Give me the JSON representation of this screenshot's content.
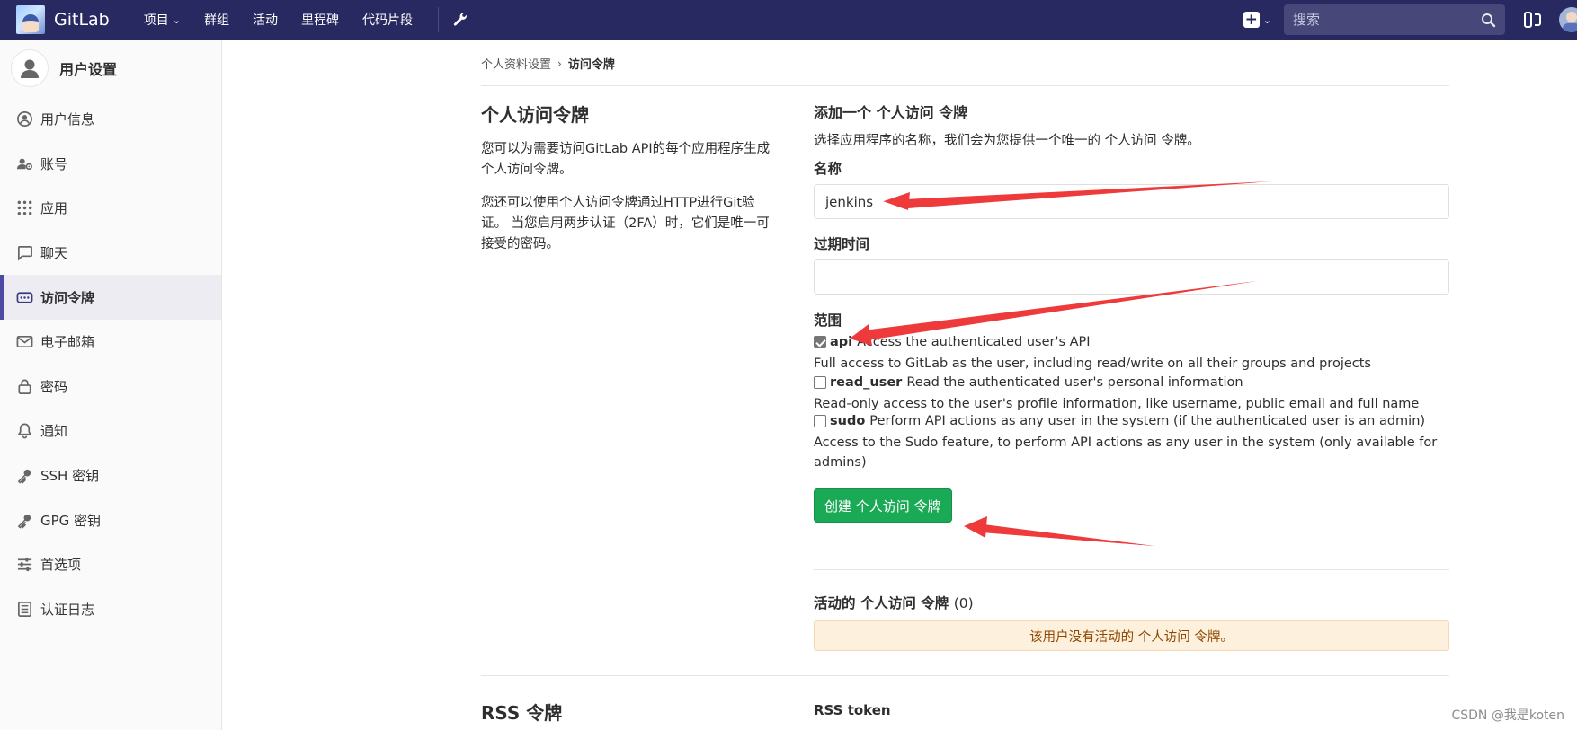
{
  "page": {
    "title": "GitLab",
    "watermark": "CSDN @我是koten"
  },
  "colors": {
    "navbar": "#292961",
    "accent": "#4b4ba3",
    "green": "#1aaa55",
    "arrow": "#ee3a3a"
  },
  "navbar": {
    "brand": "GitLab",
    "menu": [
      "项目",
      "群组",
      "活动",
      "里程碑",
      "代码片段"
    ],
    "search_placeholder": "搜索"
  },
  "sidebar": {
    "header": "用户设置",
    "active_index": 4,
    "items": [
      {
        "label": "用户信息",
        "icon": "profile-icon"
      },
      {
        "label": "账号",
        "icon": "account-icon"
      },
      {
        "label": "应用",
        "icon": "apps-grid-icon"
      },
      {
        "label": "聊天",
        "icon": "chat-icon"
      },
      {
        "label": "访问令牌",
        "icon": "token-icon"
      },
      {
        "label": "电子邮箱",
        "icon": "mail-icon"
      },
      {
        "label": "密码",
        "icon": "lock-icon"
      },
      {
        "label": "通知",
        "icon": "bell-icon"
      },
      {
        "label": "SSH 密钥",
        "icon": "key-icon"
      },
      {
        "label": "GPG 密钥",
        "icon": "key-icon"
      },
      {
        "label": "首选项",
        "icon": "sliders-icon"
      },
      {
        "label": "认证日志",
        "icon": "log-icon"
      }
    ]
  },
  "breadcrumb": {
    "parent": "个人资料设置",
    "current": "访问令牌"
  },
  "intro": {
    "title": "个人访问令牌",
    "p1": "您可以为需要访问GitLab API的每个应用程序生成个人访问令牌。",
    "p2": "您还可以使用个人访问令牌通过HTTP进行Git验证。 当您启用两步认证（2FA）时，它们是唯一可接受的密码。"
  },
  "form": {
    "heading": "添加一个 个人访问 令牌",
    "description": "选择应用程序的名称，我们会为您提供一个唯一的 个人访问 令牌。",
    "name_label": "名称",
    "name_value": "jenkins",
    "expiry_label": "过期时间",
    "expiry_value": "",
    "scopes_label": "范围",
    "scopes": [
      {
        "name": "api",
        "summary": "Access the authenticated user's API",
        "detail": "Full access to GitLab as the user, including read/write on all their groups and projects",
        "checked": true
      },
      {
        "name": "read_user",
        "summary": "Read the authenticated user's personal information",
        "detail": "Read-only access to the user's profile information, like username, public email and full name",
        "checked": false
      },
      {
        "name": "sudo",
        "summary": "Perform API actions as any user in the system (if the authenticated user is an admin)",
        "detail": "Access to the Sudo feature, to perform API actions as any user in the system (only available for admins)",
        "checked": false
      }
    ],
    "submit_label": "创建 个人访问 令牌"
  },
  "active_tokens": {
    "heading": "活动的 个人访问 令牌",
    "count": "(0)",
    "empty_message": "该用户没有活动的 个人访问 令牌。"
  },
  "rss": {
    "title": "RSS 令牌",
    "label": "RSS token"
  }
}
